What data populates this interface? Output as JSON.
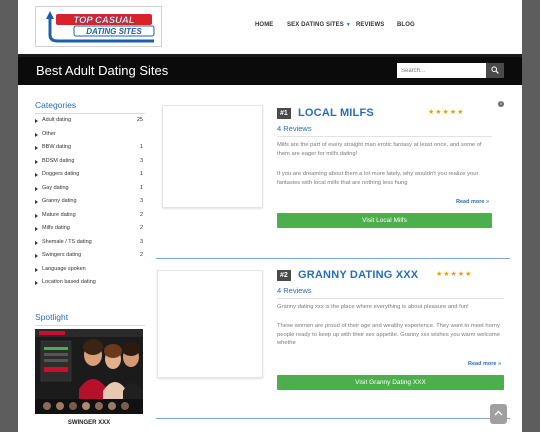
{
  "header": {
    "logo_text": "TOP CASUAL DATING SITES",
    "nav": [
      {
        "label": "HOME"
      },
      {
        "label": "SEX DATING SITES",
        "has_dropdown": true
      },
      {
        "label": "REVIEWS"
      },
      {
        "label": "BLOG"
      }
    ]
  },
  "titlebar": {
    "title": "Best Adult Dating Sites",
    "search_placeholder": "Search..."
  },
  "sidebar": {
    "categories_heading": "Categories",
    "categories": [
      {
        "label": "Adult dating",
        "count": "25"
      },
      {
        "label": "Other",
        "count": ""
      },
      {
        "label": "BBW dating",
        "count": "1"
      },
      {
        "label": "BDSM dating",
        "count": "3"
      },
      {
        "label": "Doggers dating",
        "count": "1"
      },
      {
        "label": "Gay dating",
        "count": "1"
      },
      {
        "label": "Granny dating",
        "count": "3"
      },
      {
        "label": "Mature dating",
        "count": "2"
      },
      {
        "label": "Milfs dating",
        "count": "2"
      },
      {
        "label": "Shemale / TS dating",
        "count": "3"
      },
      {
        "label": "Swingers dating",
        "count": "2"
      },
      {
        "label": "Language spoken",
        "count": ""
      },
      {
        "label": "Location based dating",
        "count": ""
      }
    ],
    "spotlight_heading": "Spotlight",
    "spotlight_caption": "SWINGER XXX"
  },
  "listings": [
    {
      "rank": "#1",
      "title": "LOCAL MILFS",
      "rating": 5,
      "stars": "★★★★★",
      "reviews": "4 Reviews",
      "para1": "Milfs are the part of every straight man erotic fantasy at least once, and some of them are eager for milfs dating!",
      "para2": "If you are dreaming about them a lot more lately, why wouldn't you realize your fantasies with local milfs that are nothing less hung",
      "read_more": "Read more »",
      "button": "Visit Local Milfs"
    },
    {
      "rank": "#2",
      "title": "GRANNY DATING XXX",
      "rating": 5,
      "stars": "★★★★★",
      "reviews": "4 Reviews",
      "para1": "Granny dating xxx is the place where everything is about pleasure and fun!",
      "para2": "These women are proud of their age and wealthy experience. They want to meet horny people ready to keep up with their sex appetite. Granny xxx wishes you warm welcome whethe",
      "read_more": "Read more »",
      "button": "Visit Granny Dating XXX"
    }
  ],
  "info_icon": "i",
  "colors": {
    "accent_blue": "#2a6db7",
    "button_green": "#4cae4c",
    "star_gold": "#e0a400",
    "titlebar_black": "#0b0b0b",
    "page_bg": "#5d5d5d"
  },
  "icons": [
    "search-icon",
    "info-icon",
    "caret-down-icon",
    "bullet-arrow-icon",
    "chevron-up-icon",
    "star-icon"
  ]
}
